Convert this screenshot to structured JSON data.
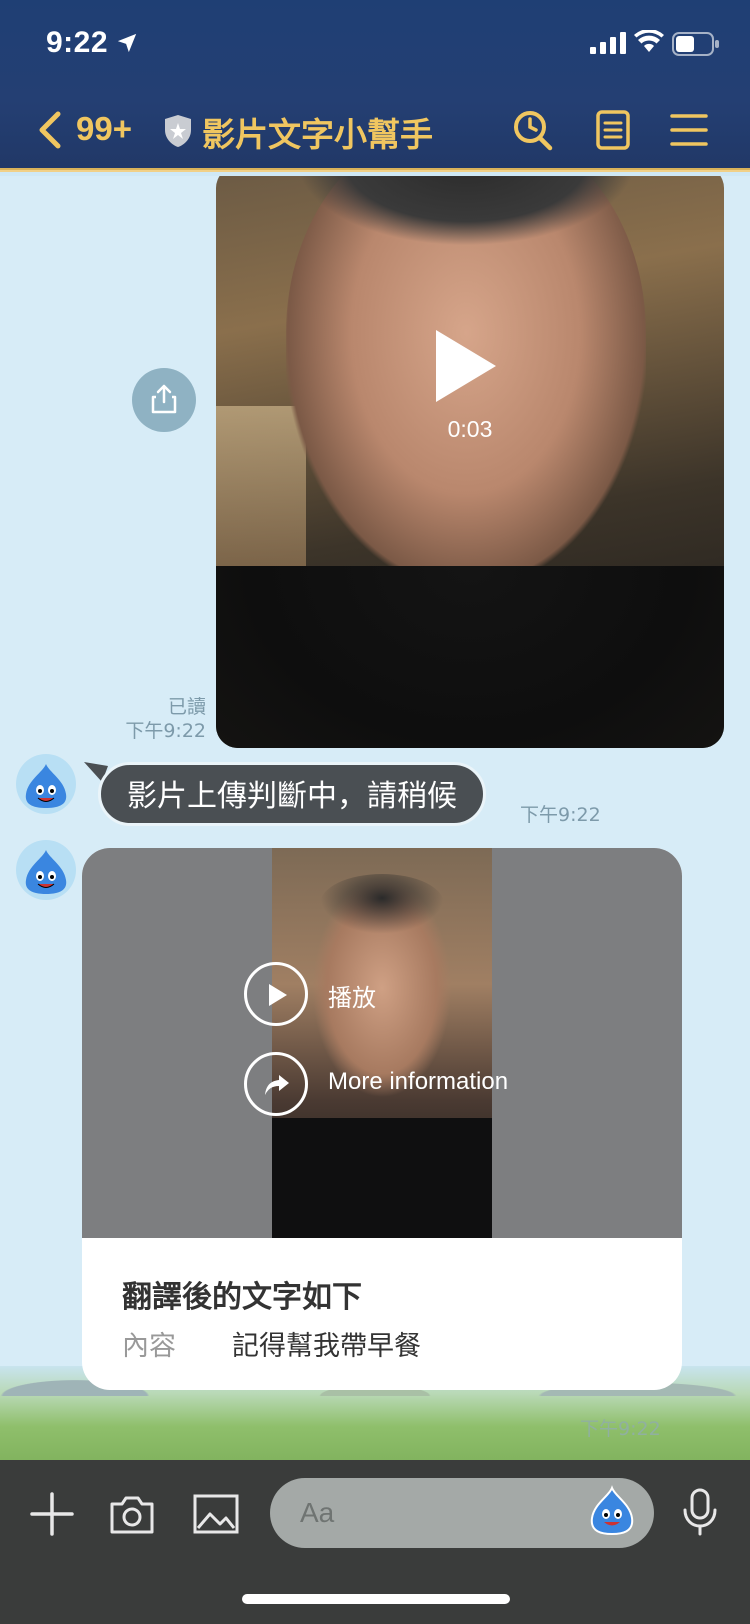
{
  "status_bar": {
    "time": "9:22"
  },
  "nav": {
    "back_count": "99+",
    "title": "影片文字小幫手"
  },
  "chat": {
    "sent_video": {
      "duration": "0:03",
      "read_label": "已讀",
      "time": "下午9:22"
    },
    "bot_message": {
      "text": "影片上傳判斷中，請稍候",
      "time": "下午9:22"
    },
    "result_card": {
      "buttons": [
        {
          "label": "播放",
          "icon": "play-icon"
        },
        {
          "label": "More information",
          "icon": "forward-icon"
        }
      ],
      "title": "翻譯後的文字如下",
      "field_label": "內容",
      "field_value": "記得幫我帶早餐",
      "time": "下午9:22"
    }
  },
  "input_bar": {
    "placeholder": "Aa"
  },
  "colors": {
    "header_bg": "#213867",
    "accent_gold": "#f0c660",
    "chat_bg": "#d7ecf7",
    "input_bar_bg": "#3a3c3b"
  }
}
